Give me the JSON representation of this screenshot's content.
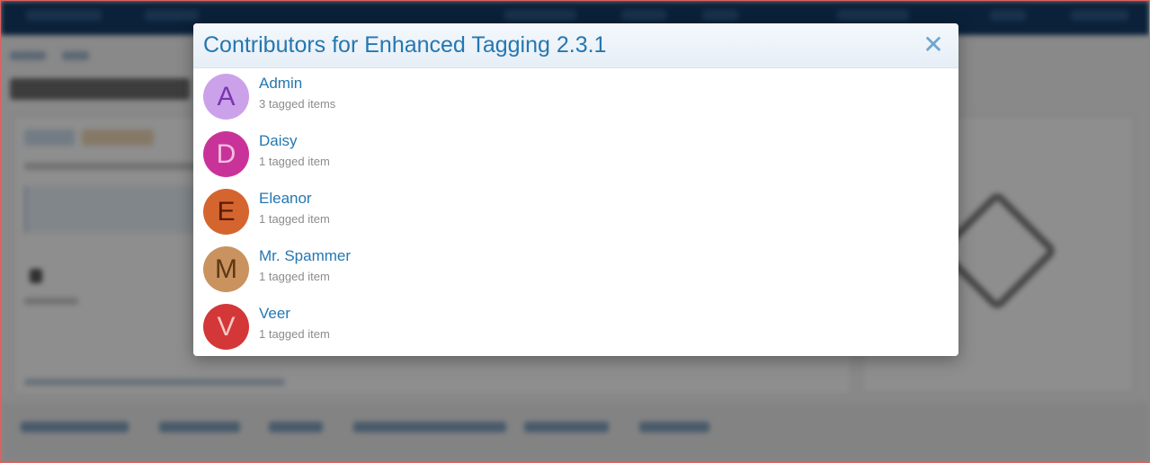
{
  "modal": {
    "title": "Contributors for Enhanced Tagging 2.3.1",
    "close_icon": "close-icon",
    "contributors": [
      {
        "initial": "A",
        "name": "Admin",
        "count": "3 tagged items",
        "bg": "#cba2ea",
        "fg": "#7b35b0"
      },
      {
        "initial": "D",
        "name": "Daisy",
        "count": "1 tagged item",
        "bg": "#c93399",
        "fg": "#f3bfe2"
      },
      {
        "initial": "E",
        "name": "Eleanor",
        "count": "1 tagged item",
        "bg": "#d5652f",
        "fg": "#5a1c06"
      },
      {
        "initial": "M",
        "name": "Mr. Spammer",
        "count": "1 tagged item",
        "bg": "#c9925f",
        "fg": "#5e3814"
      },
      {
        "initial": "V",
        "name": "Veer",
        "count": "1 tagged item",
        "bg": "#d43737",
        "fg": "#f7c7c7"
      }
    ]
  }
}
